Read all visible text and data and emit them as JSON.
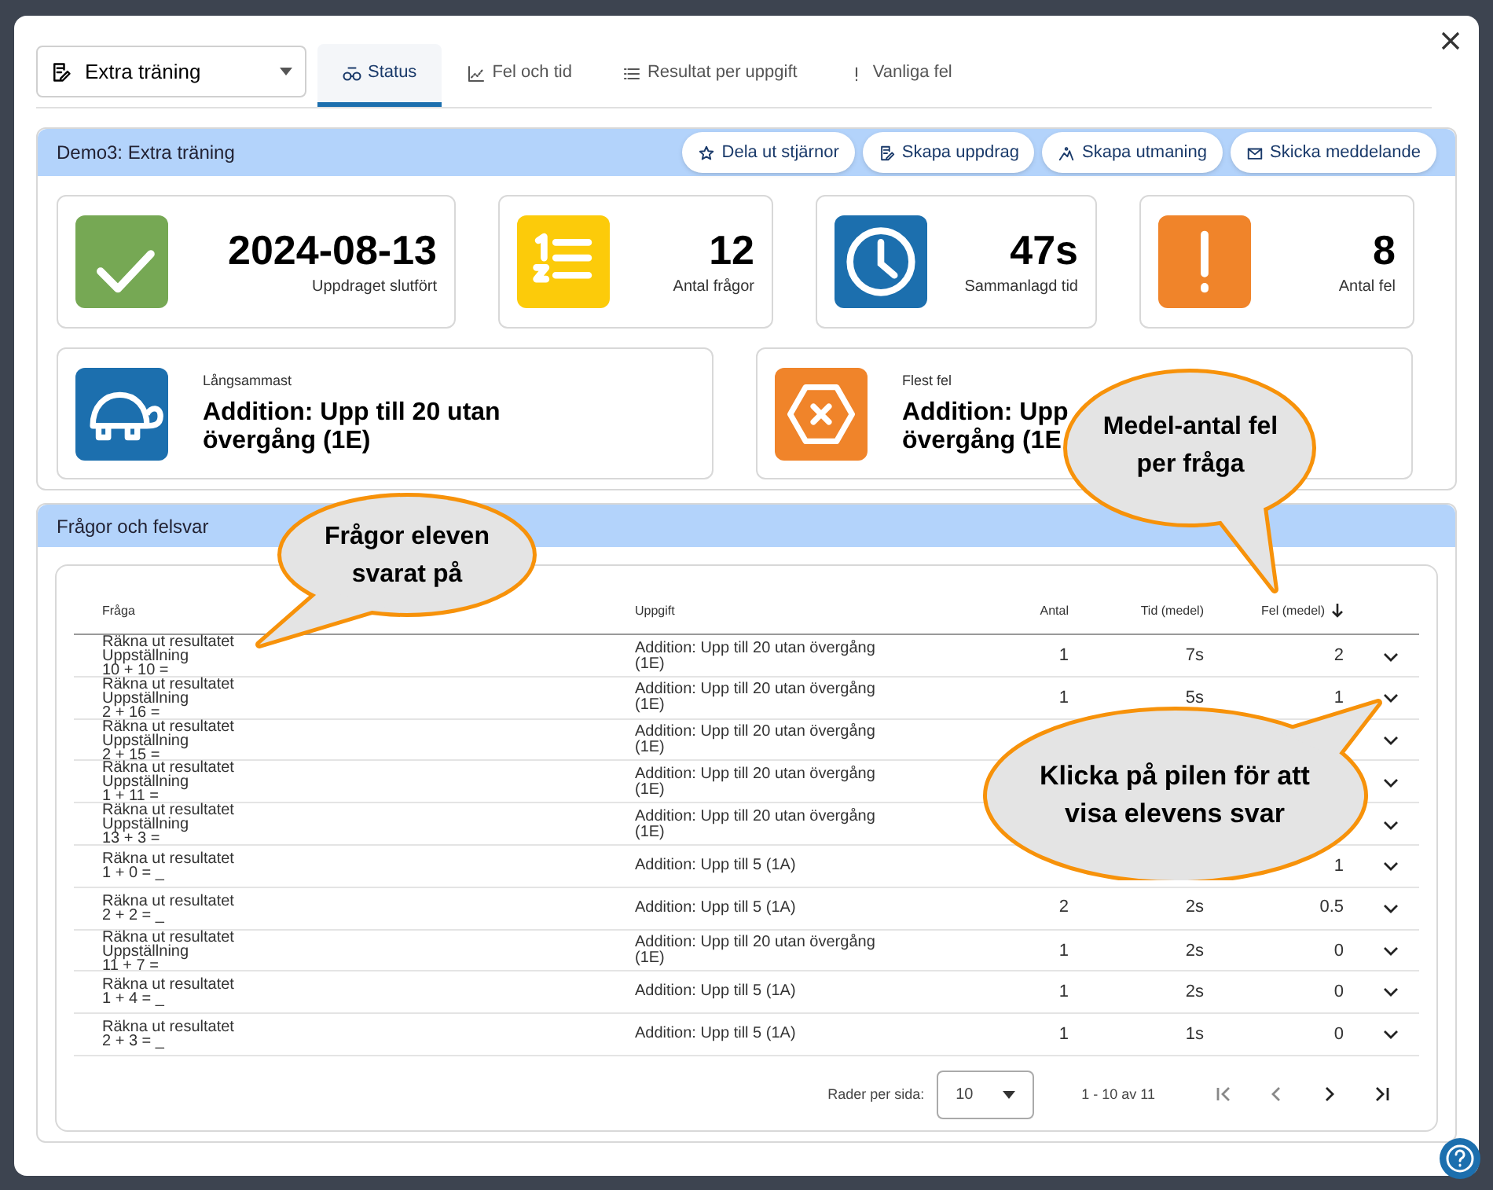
{
  "assignment_select": {
    "value": "Extra träning"
  },
  "tabs": [
    {
      "label": "Status",
      "selected": true
    },
    {
      "label": "Fel och tid",
      "selected": false
    },
    {
      "label": "Resultat per uppgift",
      "selected": false
    },
    {
      "label": "Vanliga fel",
      "selected": false
    }
  ],
  "overview": {
    "title": "Demo3: Extra träning",
    "actions": [
      {
        "label": "Dela ut stjärnor"
      },
      {
        "label": "Skapa uppdrag"
      },
      {
        "label": "Skapa utmaning"
      },
      {
        "label": "Skicka meddelande"
      }
    ],
    "stats": [
      {
        "value": "2024-08-13",
        "label": "Uppdraget slutfört",
        "color": "#76a854"
      },
      {
        "value": "12",
        "label": "Antal frågor",
        "color": "#fccb0a"
      },
      {
        "value": "47s",
        "label": "Sammanlagd tid",
        "color": "#1c6fae"
      },
      {
        "value": "8",
        "label": "Antal fel",
        "color": "#f0842a"
      }
    ],
    "highlights": [
      {
        "label": "Långsammast",
        "lines": [
          "Addition: Upp till 20 utan",
          "övergång (1E)"
        ],
        "color": "#1c6fae"
      },
      {
        "label": "Flest fel",
        "lines": [
          "Addition: Upp",
          "övergång (1E"
        ],
        "color": "#f0842a"
      }
    ]
  },
  "questions": {
    "title": "Frågor och felsvar",
    "columns": [
      "Fråga",
      "Uppgift",
      "Antal",
      "Tid (medel)",
      "Fel (medel)"
    ],
    "rows": [
      {
        "question": [
          "Räkna ut resultatet",
          "Uppställning",
          "10 + 10 ="
        ],
        "task": [
          "Addition: Upp till 20 utan övergång",
          "(1E)"
        ],
        "count": "1",
        "time": "7s",
        "errors": "2"
      },
      {
        "question": [
          "Räkna ut resultatet",
          "Uppställning",
          "2 + 16 ="
        ],
        "task": [
          "Addition: Upp till 20 utan övergång",
          "(1E)"
        ],
        "count": "1",
        "time": "5s",
        "errors": "1"
      },
      {
        "question": [
          "Räkna ut resultatet",
          "Uppställning",
          "2 + 15 ="
        ],
        "task": [
          "Addition: Upp till 20 utan övergång",
          "(1E)"
        ]
      },
      {
        "question": [
          "Räkna ut resultatet",
          "Uppställning",
          "1 + 11 ="
        ],
        "task": [
          "Addition: Upp till 20 utan övergång",
          "(1E)"
        ]
      },
      {
        "question": [
          "Räkna ut resultatet",
          "Uppställning",
          "13 + 3 ="
        ],
        "task": [
          "Addition: Upp till 20 utan övergång",
          "(1E)"
        ]
      },
      {
        "question": [
          "Räkna ut resultatet",
          "1 + 0 = _"
        ],
        "task": [
          "Addition: Upp till 5 (1A)"
        ],
        "errors": "1"
      },
      {
        "question": [
          "Räkna ut resultatet",
          "2 + 2 = _"
        ],
        "task": [
          "Addition: Upp till 5 (1A)"
        ],
        "count": "2",
        "time": "2s",
        "errors": "0.5"
      },
      {
        "question": [
          "Räkna ut resultatet",
          "Uppställning",
          "11 + 7 ="
        ],
        "task": [
          "Addition: Upp till 20 utan övergång",
          "(1E)"
        ],
        "count": "1",
        "time": "2s",
        "errors": "0"
      },
      {
        "question": [
          "Räkna ut resultatet",
          "1 + 4 = _"
        ],
        "task": [
          "Addition: Upp till 5 (1A)"
        ],
        "count": "1",
        "time": "2s",
        "errors": "0"
      },
      {
        "question": [
          "Räkna ut resultatet",
          "2 + 3 = _"
        ],
        "task": [
          "Addition: Upp till 5 (1A)"
        ],
        "count": "1",
        "time": "1s",
        "errors": "0"
      }
    ],
    "pagination": {
      "rows_label": "Rader per sida:",
      "rows_value": "10",
      "range": "1 - 10 av 11"
    }
  },
  "callouts": [
    {
      "text": "Frågor eleven svarat på",
      "kind": "left"
    },
    {
      "text": "Medel-antal fel per fråga",
      "kind": "down"
    },
    {
      "text": "Klicka på pilen för att visa elevens svar",
      "kind": "up"
    }
  ]
}
